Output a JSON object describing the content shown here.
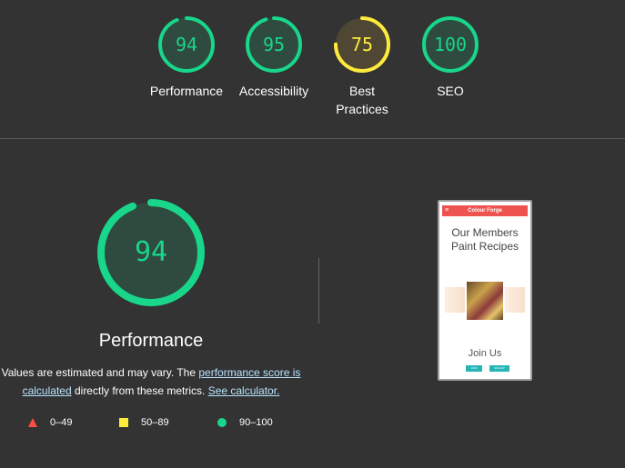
{
  "categories": [
    {
      "score": "94",
      "label": "Performance",
      "color": "#18d68a",
      "fraction": 0.94
    },
    {
      "score": "95",
      "label": "Accessibility",
      "color": "#18d68a",
      "fraction": 0.95
    },
    {
      "score": "75",
      "label": "Best Practices",
      "color": "#ffeb3b",
      "fraction": 0.75
    },
    {
      "score": "100",
      "label": "SEO",
      "color": "#18d68a",
      "fraction": 1.0
    }
  ],
  "main": {
    "score": "94",
    "fraction": 0.94,
    "title": "Performance",
    "note_prefix": "Values are estimated and may vary. The ",
    "note_link1": "performance score is calculated",
    "note_middle": " directly from these metrics. ",
    "note_link2": "See calculator."
  },
  "legend": [
    {
      "shape": "triangle",
      "color": "#ff4e42",
      "range": "0–49"
    },
    {
      "shape": "square",
      "color": "#ffeb3b",
      "range": "50–89"
    },
    {
      "shape": "circle",
      "color": "#18d68a",
      "range": "90–100"
    }
  ],
  "screenshot": {
    "app_title": "Colour Forge",
    "heading": "Our Members Paint Recipes",
    "join": "Join Us",
    "btn1": "JOIN",
    "btn2": "SIGNUP"
  }
}
